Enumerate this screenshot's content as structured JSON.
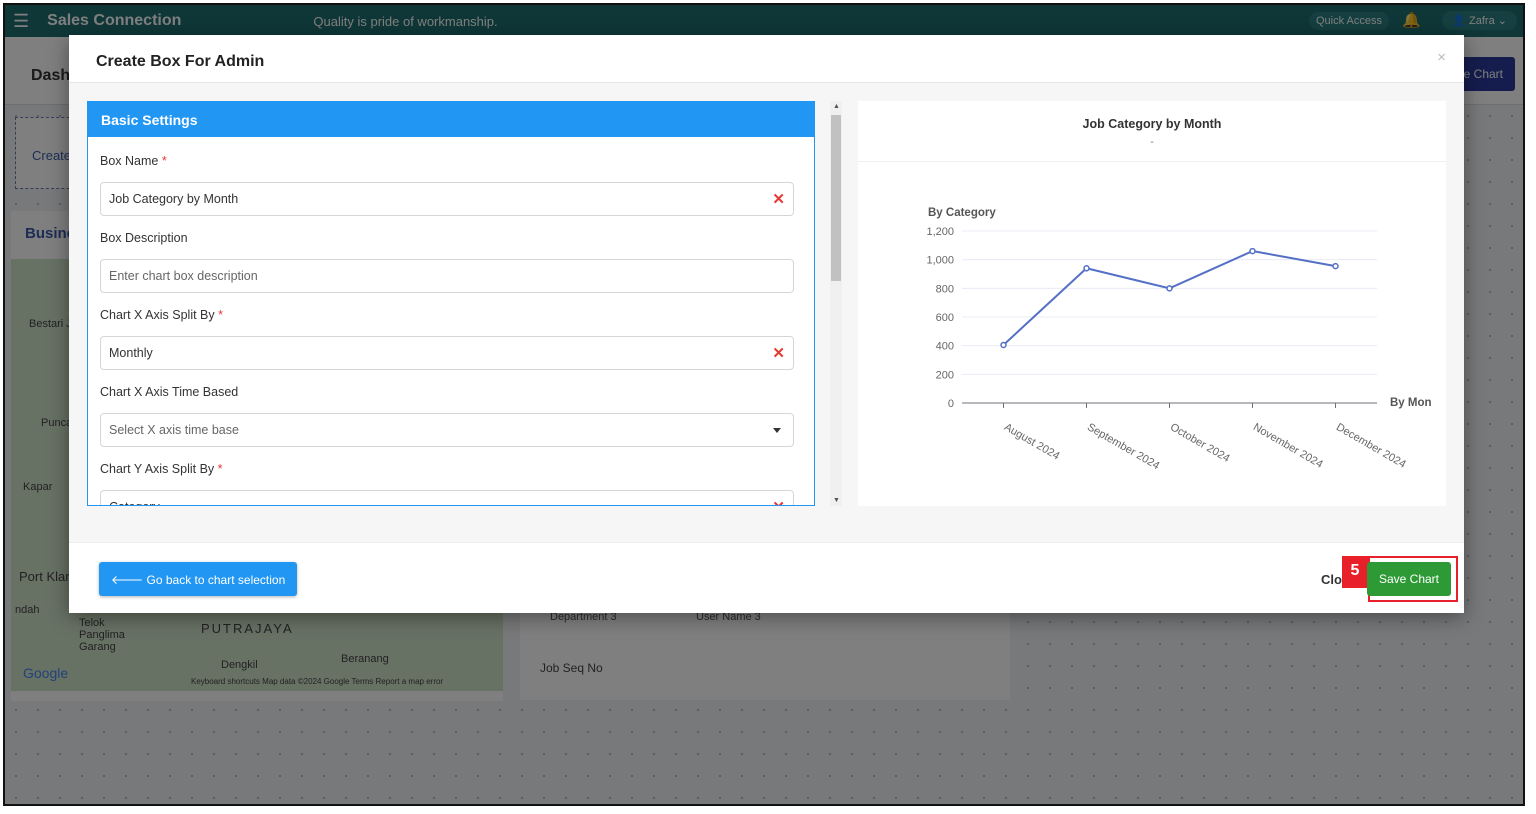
{
  "app": {
    "menu_icon": "hamburger-icon",
    "brand": "Sales Connection",
    "tagline": "Quality is pride of workmanship.",
    "quick_access": "Quick Access",
    "bell_icon": "bell-icon",
    "user": "Zafra"
  },
  "page": {
    "title": "Dash",
    "create_chart_partial": "e Chart",
    "create_card_partial": "Create",
    "business_card_partial": "Busine",
    "map_labels": [
      "Bestari J",
      "Punca",
      "Kapar",
      "Port Klar",
      "ndah",
      "Telok Panglima Garang",
      "PUTRAJAYA",
      "Dengkil",
      "Beranang",
      "Google"
    ],
    "map_footer": "Keyboard shortcuts   Map data ©2024 Google   Terms   Report a map error",
    "job_seq": "Job Seq No",
    "chips": [
      "Department 3",
      "User Name 3"
    ]
  },
  "modal": {
    "title": "Create Box For Admin",
    "close_icon": "×",
    "form": {
      "header": "Basic Settings",
      "fields": [
        {
          "label": "Box Name",
          "required": true,
          "value": "Job Category by Month",
          "placeholder": "",
          "control": "clearable"
        },
        {
          "label": "Box Description",
          "required": false,
          "value": "",
          "placeholder": "Enter chart box description",
          "control": "text"
        },
        {
          "label": "Chart X Axis Split By",
          "required": true,
          "value": "Monthly",
          "placeholder": "",
          "control": "clearable"
        },
        {
          "label": "Chart X Axis Time Based",
          "required": false,
          "value": "",
          "placeholder": "Select X axis time base",
          "control": "dropdown"
        },
        {
          "label": "Chart Y Axis Split By",
          "required": true,
          "value": "Category",
          "placeholder": "",
          "control": "clearable"
        }
      ]
    },
    "footer": {
      "back": "Go back to chart selection",
      "close": "Clo",
      "save": "Save Chart",
      "step_badge": "5"
    }
  },
  "chart_data": {
    "type": "line",
    "title": "Job Category by Month",
    "subtitle": "-",
    "ylabel": "By Category",
    "xlabel": "By Mon",
    "categories": [
      "August 2024",
      "September 2024",
      "October 2024",
      "November 2024",
      "December 2024"
    ],
    "values": [
      405,
      940,
      800,
      1060,
      955
    ],
    "ylim": [
      0,
      1200
    ],
    "yticks": [
      "0",
      "200",
      "400",
      "600",
      "800",
      "1,000",
      "1,200"
    ],
    "grid": true,
    "color": "#5470c6"
  }
}
